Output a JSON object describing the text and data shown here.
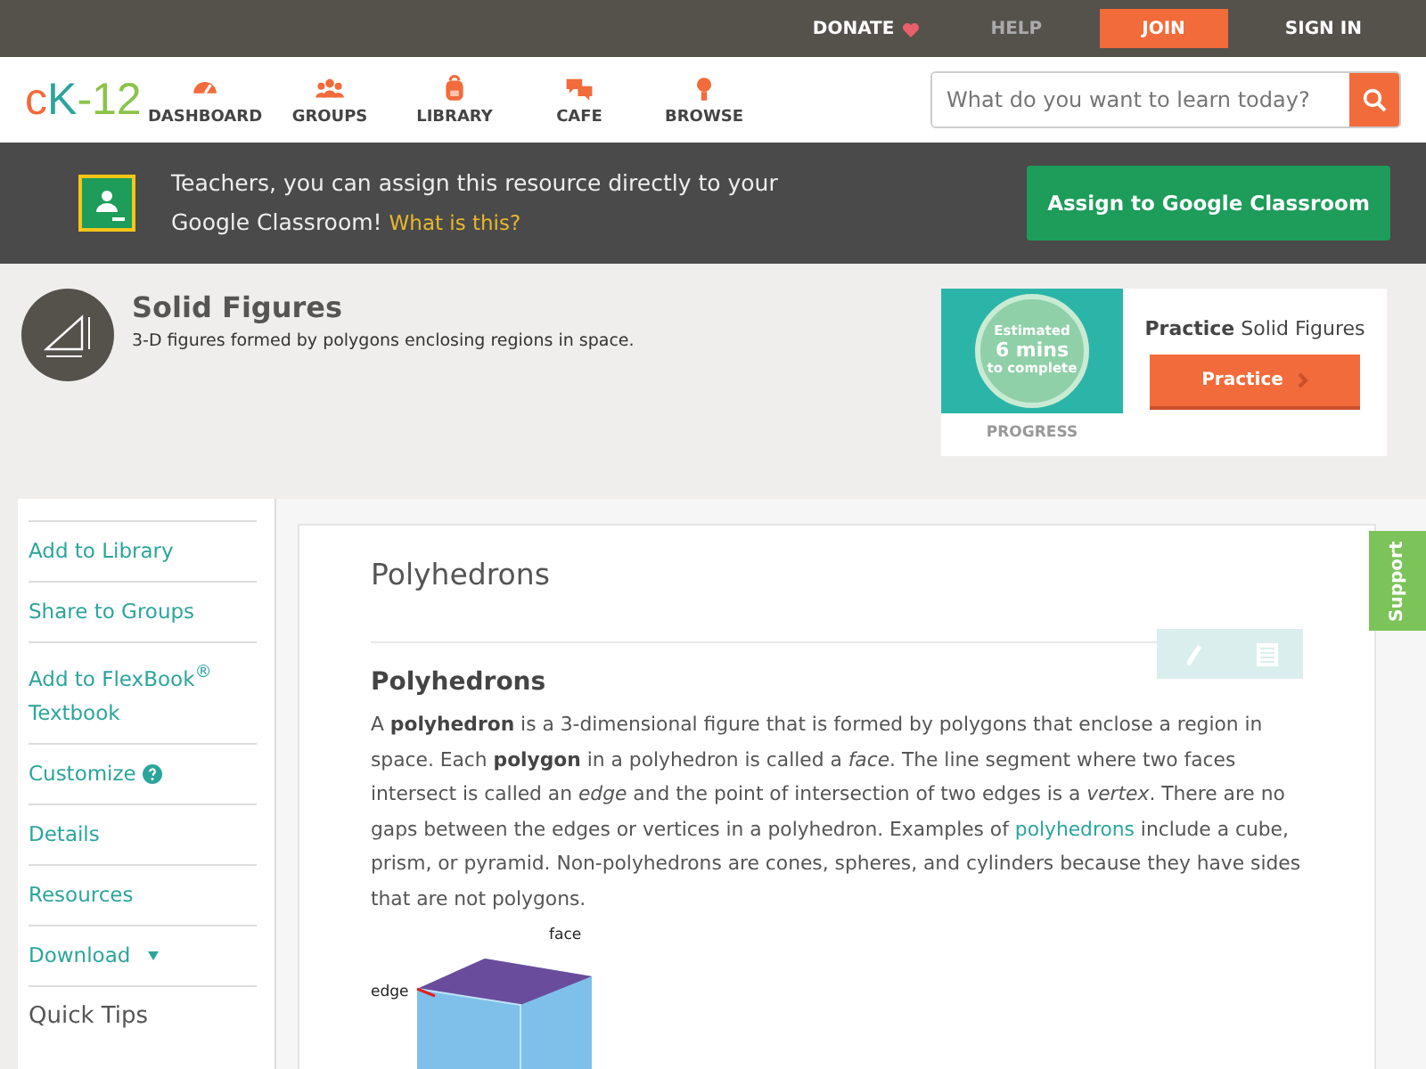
{
  "top_bar": {
    "links": [
      {
        "label": "DONATE",
        "kind": "donate"
      },
      {
        "label": "HELP",
        "kind": "muted"
      },
      {
        "label": "JOIN",
        "kind": "primary"
      },
      {
        "label": "SIGN IN",
        "kind": "plain"
      }
    ]
  },
  "nav": {
    "logo": {
      "c": "c",
      "k": "K",
      "rest": "-12"
    },
    "items": [
      {
        "label": "DASHBOARD"
      },
      {
        "label": "GROUPS"
      },
      {
        "label": "LIBRARY"
      },
      {
        "label": "CAFE"
      },
      {
        "label": "BROWSE"
      }
    ],
    "search": {
      "placeholder": "What do you want to learn today?"
    }
  },
  "classroom_banner": {
    "text": "Teachers, you can assign this resource directly to your Google Classroom!",
    "link": "What is this?",
    "button": "Assign to Google Classroom"
  },
  "concept": {
    "title": "Solid Figures",
    "description": "3-D figures formed by polygons enclosing regions in space."
  },
  "practice": {
    "estimate": [
      "Estimated",
      "6 mins",
      "to complete"
    ],
    "progress_label": "PROGRESS",
    "heading": "**Practice** Solid Figures",
    "button": "Practice"
  },
  "sidebar": {
    "items": [
      {
        "label": "Add to Library",
        "kind": "link"
      },
      {
        "label": "Share to Groups",
        "kind": "link"
      },
      {
        "label": "Add to FlexBook$^{®}$ Textbook",
        "kind": "link"
      },
      {
        "label": "Customize",
        "kind": "help"
      },
      {
        "label": "Details",
        "kind": "link"
      },
      {
        "label": "Resources",
        "kind": "link"
      },
      {
        "label": "Download",
        "kind": "dropdown"
      },
      {
        "label": "Quick Tips",
        "kind": "heading"
      }
    ]
  },
  "article": {
    "title": "Polyhedrons",
    "section_title": "Polyhedrons",
    "paragraph": {
      "before": "A **polyhedron** is a 3-dimensional figure that is formed by polygons that enclose a region in space. Each **polygon** in a polyhedron is called a *face*. The line segment where two faces intersect is called an *edge* and the point of intersection of two edges is a *vertex*. There are no gaps between the edges or vertices in a polyhedron. Examples of",
      "link": "polyhedrons",
      "after": "include a cube, prism, or pyramid. Non-polyhedrons are cones, spheres, and cylinders because they have sides that are not polygons."
    },
    "figure_labels": [
      "face",
      "edge"
    ]
  },
  "support_tab": {
    "label": "Support"
  }
}
